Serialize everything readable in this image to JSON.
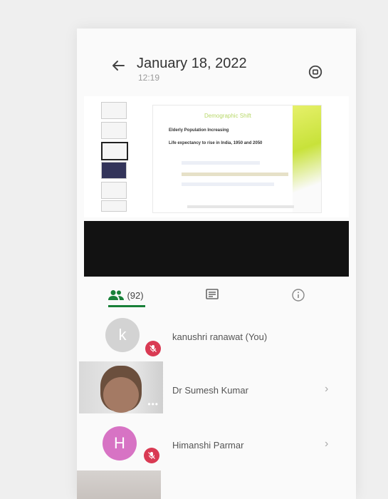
{
  "header": {
    "title": "January 18, 2022",
    "subtitle": "12:19"
  },
  "presentation": {
    "title": "Demographic Shift",
    "heading": "Elderly Population Increasing",
    "subheading": "Life expectancy to rise in India, 1950 and 2050"
  },
  "tabs": {
    "people_count": "(92)"
  },
  "participants": [
    {
      "name": "kanushri ranawat (You)",
      "initial": "k"
    },
    {
      "name": "Dr Sumesh Kumar"
    },
    {
      "name": "Himanshi Parmar",
      "initial": "H"
    }
  ],
  "icons": {
    "back": "arrow-left-icon",
    "rotate": "screen-rotate-icon",
    "people": "people-icon",
    "chat": "chat-icon",
    "info": "info-icon",
    "mic_off": "mic-off-icon",
    "chevron": "chevron-right-icon"
  },
  "colors": {
    "accent": "#188038",
    "mute_badge": "#d93a53",
    "avatar_k": "#d3d3d3",
    "avatar_h": "#d773c4"
  }
}
